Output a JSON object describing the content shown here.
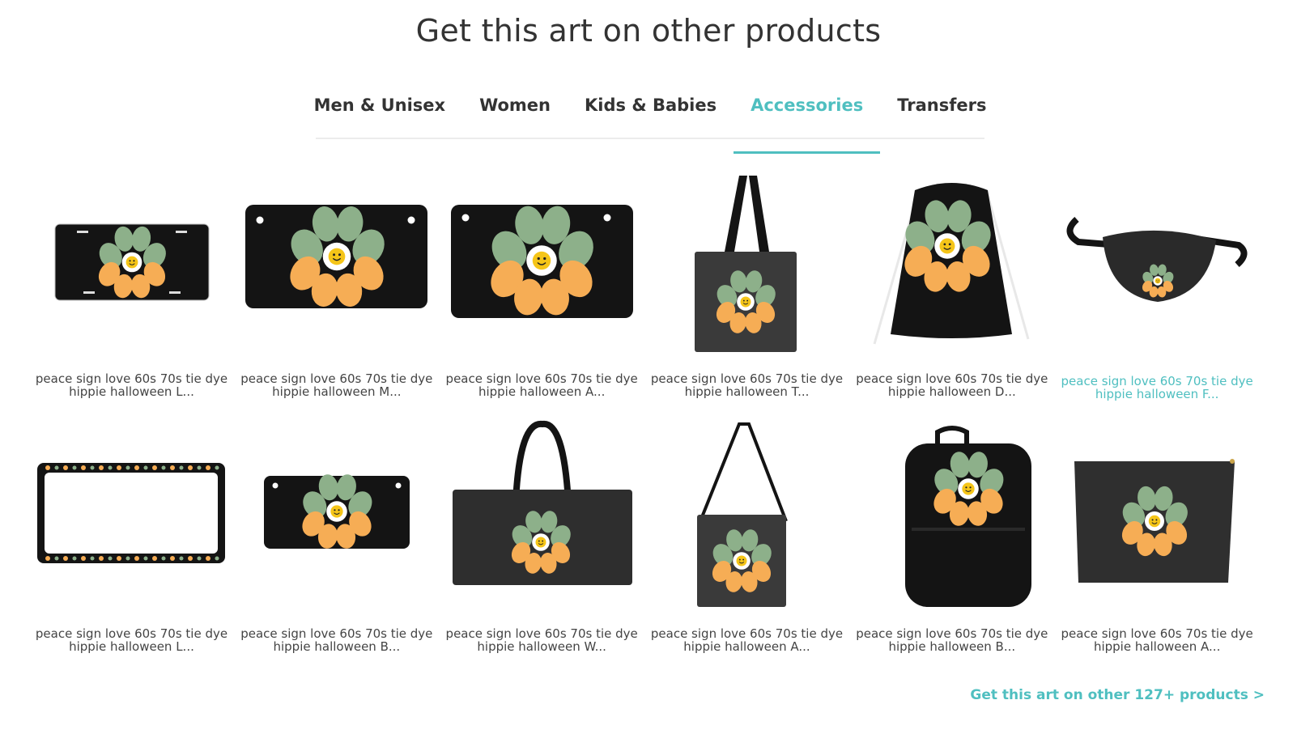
{
  "header": {
    "title": "Get this art on other products"
  },
  "tabs": [
    {
      "label": "Men & Unisex"
    },
    {
      "label": "Women"
    },
    {
      "label": "Kids & Babies"
    },
    {
      "label": "Accessories",
      "active": true
    },
    {
      "label": "Transfers"
    }
  ],
  "products": [
    {
      "line1": "peace sign love 60s 70s tie dye",
      "line2": "hippie halloween L...",
      "icon": "license-plate-small-icon"
    },
    {
      "line1": "peace sign love 60s 70s tie dye",
      "line2": "hippie halloween M...",
      "icon": "motorcycle-plate-icon"
    },
    {
      "line1": "peace sign love 60s 70s tie dye",
      "line2": "hippie halloween A...",
      "icon": "aluminum-sign-icon"
    },
    {
      "line1": "peace sign love 60s 70s tie dye",
      "line2": "hippie halloween T...",
      "icon": "tote-bag-icon"
    },
    {
      "line1": "peace sign love 60s 70s tie dye",
      "line2": "hippie halloween D...",
      "icon": "drawstring-bag-icon"
    },
    {
      "line1": "peace sign love 60s 70s tie dye",
      "line2": "hippie halloween F...",
      "icon": "fanny-pack-icon",
      "highlighted": true
    },
    {
      "line1": "peace sign love 60s 70s tie dye",
      "line2": "hippie halloween L...",
      "icon": "license-plate-frame-icon"
    },
    {
      "line1": "peace sign love 60s 70s tie dye",
      "line2": "hippie halloween B...",
      "icon": "bicycle-plate-icon"
    },
    {
      "line1": "peace sign love 60s 70s tie dye",
      "line2": "hippie halloween W...",
      "icon": "weekender-bag-icon"
    },
    {
      "line1": "peace sign love 60s 70s tie dye",
      "line2": "hippie halloween A...",
      "icon": "crossbody-tote-icon"
    },
    {
      "line1": "peace sign love 60s 70s tie dye",
      "line2": "hippie halloween B...",
      "icon": "backpack-icon"
    },
    {
      "line1": "peace sign love 60s 70s tie dye",
      "line2": "hippie halloween A...",
      "icon": "pouch-icon"
    }
  ],
  "footer": {
    "more_link": "Get this art on other 127+ products >"
  },
  "colors": {
    "accent": "#4fbfc0",
    "text": "#333333",
    "product_black": "#141414",
    "bag_gray": "#3a3a3a",
    "art_green": "#8db08a",
    "art_orange": "#f6ad55"
  }
}
